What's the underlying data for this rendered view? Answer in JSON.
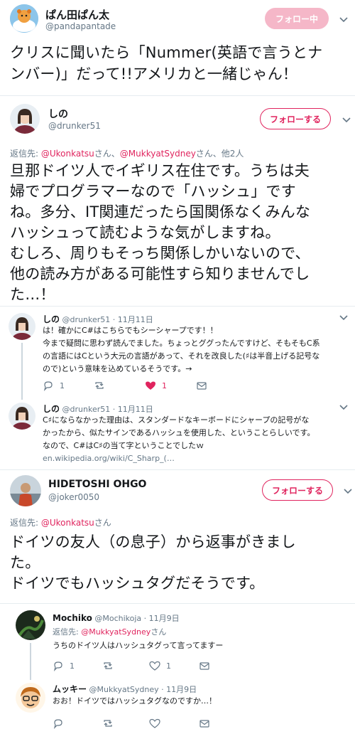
{
  "main_tweet": {
    "name": "ぱん田ぱん太",
    "handle": "@pandapantade",
    "follow_label": "フォロー中",
    "text_line1": "クリスに聞いたら「Nummer(英語で言うとナ",
    "text_line2": "ンバー)」だって!!アメリカと一緒じゃん！"
  },
  "reply1": {
    "name": "しの",
    "handle": "@drunker51",
    "follow_label": "フォローする",
    "replying_prefix": "返信先: ",
    "replying_user1": "@Ukonkatsu",
    "replying_san1": "さん、",
    "replying_user2": "@MukkyatSydney",
    "replying_suffix": "さん、他2人",
    "lines": [
      "旦那ドイツ人でイギリス在住です。うちは夫",
      "婦でプログラマーなので「ハッシュ」です",
      "ね。多分、IT関連だったら国関係なくみんな",
      "ハッシュって読むような気がしますね。",
      "むしろ、周りもそっち関係しかいないので、",
      "他の読み方がある可能性すら知りませんでし",
      "た…！"
    ]
  },
  "thread1": {
    "name": "しの",
    "handle": "@drunker51",
    "date": "· 11月11日",
    "lines": [
      "は！確かにC#はこちらでもシーシャープです！！",
      "今まで疑問に思わず読んでました。ちょっとググったんですけど、そもそもC系",
      "の言語にはCという大元の言語があって、それを改良した(♯は半音上げる記号な",
      "ので)という意味を込めているそうです。→"
    ],
    "reply_count": "1",
    "like_count": "1"
  },
  "thread2": {
    "name": "しの",
    "handle": "@drunker51",
    "date": "· 11月11日",
    "lines": [
      "C♯にならなかった理由は、スタンダードなキーボードにシャープの記号がな",
      "かったから、似たサインであるハッシュを使用した、ということらしいです。",
      "なので、C#はC♯の当て字ということでしたｗ"
    ],
    "link": "en.wikipedia.org/wiki/C_Sharp_(…"
  },
  "reply2": {
    "name": "HIDETOSHI OHGO",
    "handle": "@joker0050",
    "follow_label": "フォローする",
    "replying_prefix": "返信先: ",
    "replying_user1": "@Ukonkatsu",
    "replying_suffix": "さん",
    "lines": [
      "ドイツの友人（の息子）から返事がきまし",
      "た。",
      "ドイツでもハッシュタグだそうです。"
    ]
  },
  "thread3": {
    "name": "Mochiko",
    "handle": "@Mochikoja",
    "date": "· 11月9日",
    "replying_prefix": "返信先: ",
    "replying_user1": "@MukkyatSydney",
    "replying_suffix": "さん",
    "text": "うちのドイツ人はハッシュタグって言ってますー",
    "reply_count": "1",
    "like_count": "1"
  },
  "thread4": {
    "name": "ムッキー",
    "handle": "@MukkyatSydney",
    "date": "· 11月9日",
    "text": "おお！ドイツではハッシュタグなのですか…！"
  },
  "colors": {
    "accent": "#e0245e",
    "text": "#14171a",
    "muted": "#657786",
    "border": "#e6ecf0",
    "thread_line": "#ccd6dd"
  }
}
